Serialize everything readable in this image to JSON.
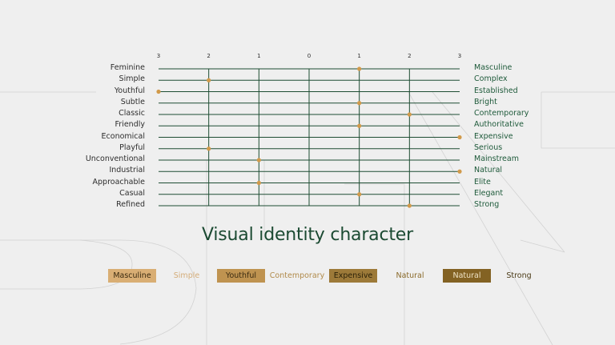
{
  "colors": {
    "background": "#efefef",
    "grid": "#1e4d33",
    "marker": "#d19a4a",
    "title": "#1b4a32",
    "right_label": "#1e5a3a"
  },
  "chart_data": {
    "type": "scatter",
    "title": "Visual identity character",
    "x_ticks": [
      "3",
      "2",
      "1",
      "0",
      "1",
      "2",
      "3"
    ],
    "xlim": [
      -3,
      3
    ],
    "rows": [
      {
        "left": "Feminine",
        "right": "Masculine",
        "value": 1
      },
      {
        "left": "Simple",
        "right": "Complex",
        "value": -2
      },
      {
        "left": "Youthful",
        "right": "Established",
        "value": -3
      },
      {
        "left": "Subtle",
        "right": "Bright",
        "value": 1
      },
      {
        "left": "Classic",
        "right": "Contemporary",
        "value": 2
      },
      {
        "left": "Friendly",
        "right": "Authoritative",
        "value": 1
      },
      {
        "left": "Economical",
        "right": "Expensive",
        "value": 3
      },
      {
        "left": "Playful",
        "right": "Serious",
        "value": -2
      },
      {
        "left": "Unconventional",
        "right": "Mainstream",
        "value": -1
      },
      {
        "left": "Industrial",
        "right": "Natural",
        "value": 3
      },
      {
        "left": "Approachable",
        "right": "Elite",
        "value": -1
      },
      {
        "left": "Casual",
        "right": "Elegant",
        "value": 1
      },
      {
        "left": "Refined",
        "right": "Strong",
        "value": 2
      }
    ],
    "legend": [
      {
        "label": "Masculine",
        "bg": "#d9ae74",
        "fg": "#3a2a10"
      },
      {
        "label": "Simple",
        "bg": "",
        "fg": "#d4ac78"
      },
      {
        "label": "Youthful",
        "bg": "#bf9350",
        "fg": "#3a2a10"
      },
      {
        "label": "Contemporary",
        "bg": "",
        "fg": "#b08a4a"
      },
      {
        "label": "Expensive",
        "bg": "#9d7a39",
        "fg": "#2d2208"
      },
      {
        "label": "Natural",
        "bg": "",
        "fg": "#8a6a2a"
      },
      {
        "label": "Natural",
        "bg": "#836223",
        "fg": "#efe3c6"
      },
      {
        "label": "Strong",
        "bg": "",
        "fg": "#4a3a16"
      }
    ]
  }
}
